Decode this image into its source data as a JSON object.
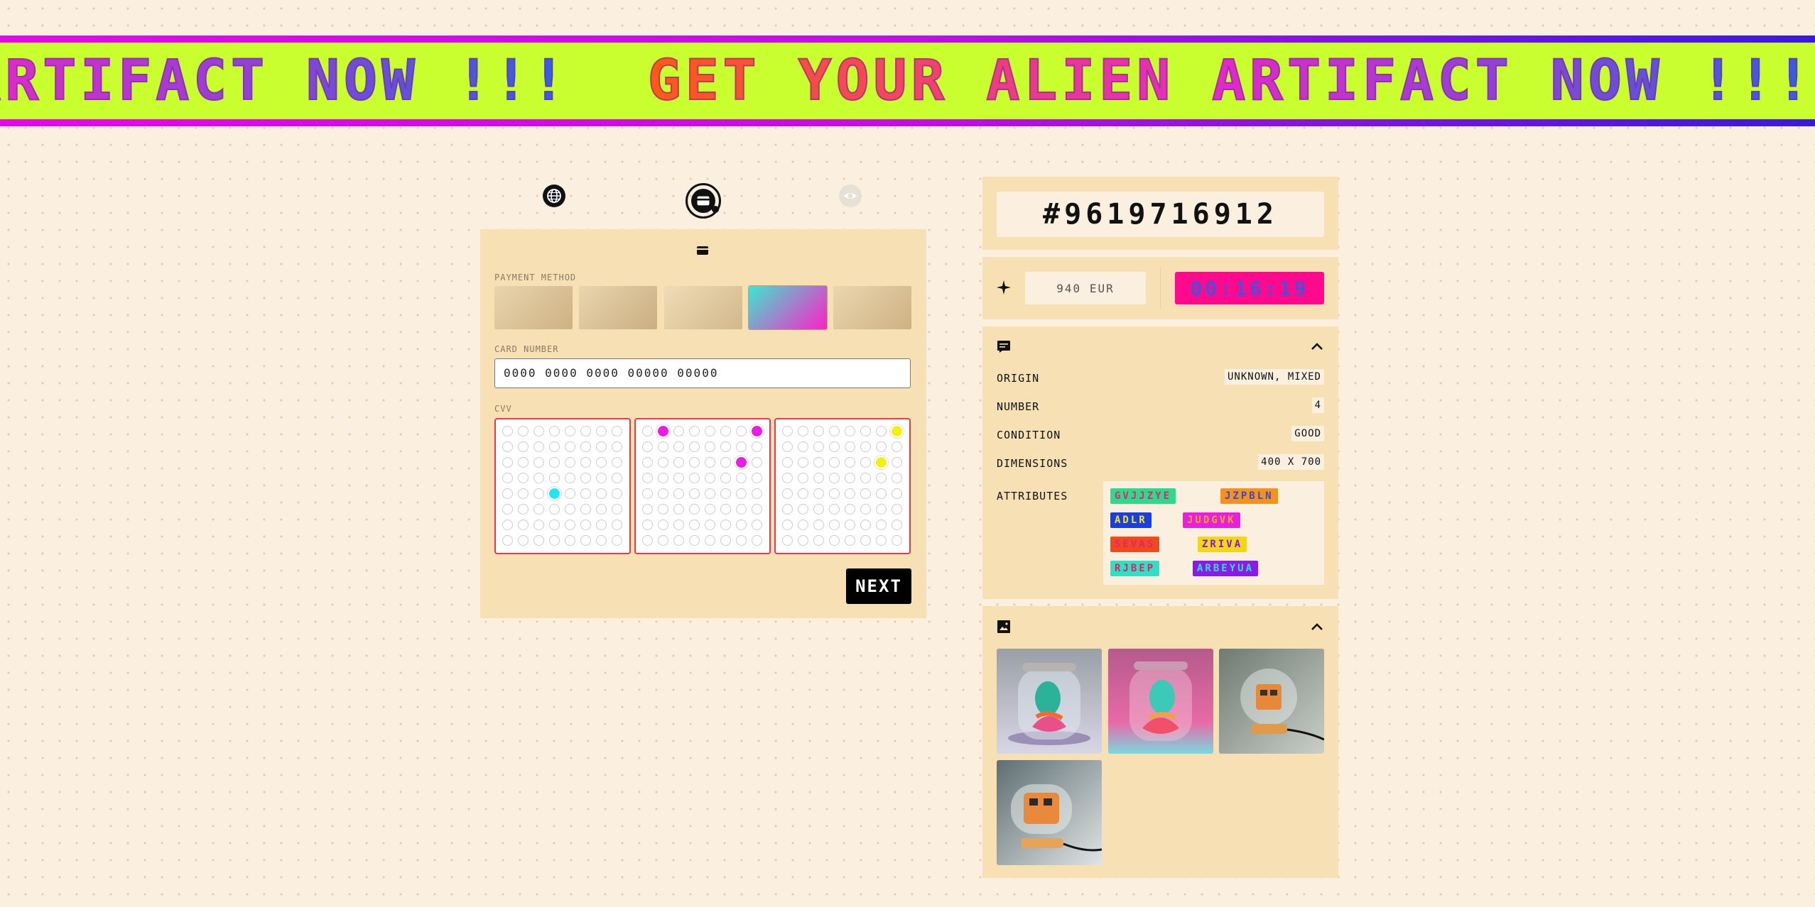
{
  "banner": {
    "text": "GET YOUR ALIEN ARTIFACT NOW !!!"
  },
  "steps": [
    {
      "icon": "globe-icon",
      "state": "done"
    },
    {
      "icon": "credit-card-icon",
      "state": "active"
    },
    {
      "icon": "eye-icon",
      "state": "pending"
    }
  ],
  "payment": {
    "section_icon": "credit-card-icon",
    "method_label": "PAYMENT METHOD",
    "methods": [
      {
        "gradient": [
          "#e9d4ad",
          "#cdb283"
        ]
      },
      {
        "gradient": [
          "#ead5ae",
          "#c9ae80"
        ]
      },
      {
        "gradient": [
          "#efdcb6",
          "#d2b88b"
        ]
      },
      {
        "gradient": [
          "#3fe6cf",
          "#ff20c8"
        ]
      },
      {
        "gradient": [
          "#ebd6ae",
          "#cdb283"
        ]
      }
    ],
    "selected_method_index": 3,
    "card_label": "CARD NUMBER",
    "card_value": "0000 0000 0000 00000 00000",
    "cvv_label": "CVV",
    "cvv_digits": [
      {
        "row": 4,
        "col": 3,
        "color": "#25e5f5"
      },
      {
        "row": 0,
        "col": 1,
        "color": "#e81ee0"
      },
      {
        "row": 0,
        "col": 7,
        "color": "#e81ee0"
      },
      {
        "row": 2,
        "col": 6,
        "color": "#e81ee0"
      },
      {
        "row": 0,
        "col": 7,
        "color": "#f5ee13"
      },
      {
        "row": 2,
        "col": 6,
        "color": "#f5ee13"
      }
    ],
    "next_label": "NEXT"
  },
  "artifact": {
    "id": "#9619716912",
    "price": "940 EUR",
    "timer": "00:16:19",
    "info": [
      {
        "key": "ORIGIN",
        "value": "UNKNOWN, MIXED"
      },
      {
        "key": "NUMBER",
        "value": "4"
      },
      {
        "key": "CONDITION",
        "value": "GOOD"
      },
      {
        "key": "DIMENSIONS",
        "value": "400 X 700"
      }
    ],
    "attributes_label": "ATTRIBUTES",
    "attributes": [
      {
        "text": "GVJJZYE",
        "bg": "#2fd98a",
        "fg": "#e0257a"
      },
      {
        "text": "JZPBLN",
        "bg": "#f4921c",
        "fg": "#3a46d8"
      },
      {
        "text": "ADLR",
        "bg": "#1a3fe0",
        "fg": "#f5e51a"
      },
      {
        "text": "JUDGVK",
        "bg": "#e81ee0",
        "fg": "#f5a51a"
      },
      {
        "text": "SEVAS",
        "bg": "#f04a1c",
        "fg": "#e0257a"
      },
      {
        "text": "ZRIVA",
        "bg": "#f5d51a",
        "fg": "#7a1ae0"
      },
      {
        "text": "RJBEP",
        "bg": "#2fe0c8",
        "fg": "#e81e5a"
      },
      {
        "text": "ARBEYUA",
        "bg": "#8a1ae8",
        "fg": "#2fe0c8"
      }
    ],
    "images_icon": "image-icon",
    "info_icon": "chat-icon",
    "sparkle_icon": "sparkle-icon",
    "thumbnails": [
      "alien-head-jar-1",
      "alien-head-jar-2",
      "robot-dome-lamp",
      "robot-capsule-lamp"
    ]
  }
}
